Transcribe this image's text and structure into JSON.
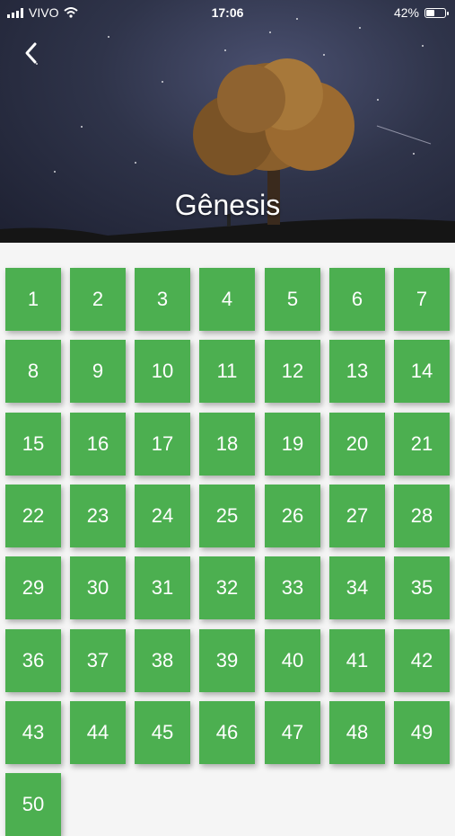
{
  "status": {
    "carrier": "VIVO",
    "time": "17:06",
    "battery": "42%"
  },
  "header": {
    "title": "Gênesis"
  },
  "chapters": [
    1,
    2,
    3,
    4,
    5,
    6,
    7,
    8,
    9,
    10,
    11,
    12,
    13,
    14,
    15,
    16,
    17,
    18,
    19,
    20,
    21,
    22,
    23,
    24,
    25,
    26,
    27,
    28,
    29,
    30,
    31,
    32,
    33,
    34,
    35,
    36,
    37,
    38,
    39,
    40,
    41,
    42,
    43,
    44,
    45,
    46,
    47,
    48,
    49,
    50
  ]
}
